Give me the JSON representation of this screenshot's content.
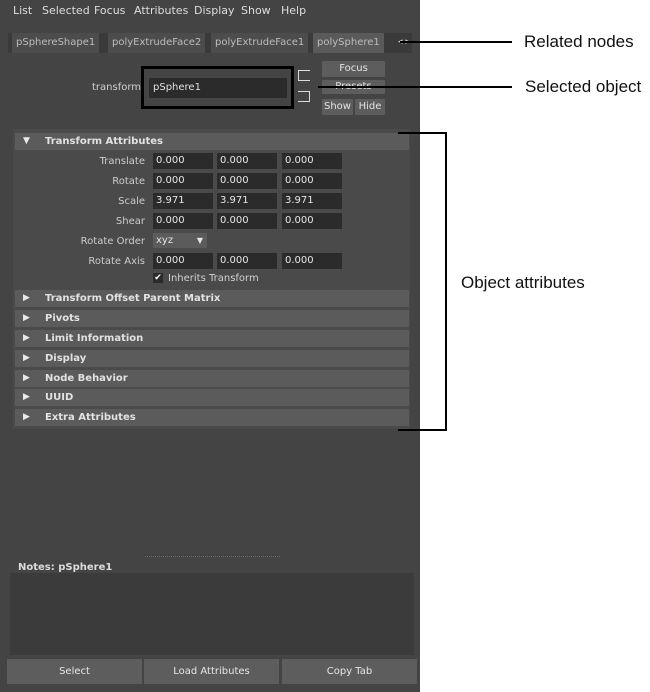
{
  "menu": [
    "List",
    "Selected",
    "Focus",
    "Attributes",
    "Display",
    "Show",
    "Help"
  ],
  "tabs": [
    "pSphereShape1",
    "polyExtrudeFace2",
    "polyExtrudeFace1",
    "polySphere1"
  ],
  "tab_arrows": "◂ ▸",
  "node": {
    "type_label": "transform",
    "name": "pSphere1"
  },
  "buttons": {
    "focus": "Focus",
    "presets": "Presets",
    "show": "Show",
    "hide": "Hide"
  },
  "transform_section": "Transform Attributes",
  "attributes": {
    "translate": {
      "label": "Translate",
      "values": [
        "0.000",
        "0.000",
        "0.000"
      ]
    },
    "rotate": {
      "label": "Rotate",
      "values": [
        "0.000",
        "0.000",
        "0.000"
      ]
    },
    "scale": {
      "label": "Scale",
      "values": [
        "3.971",
        "3.971",
        "3.971"
      ]
    },
    "shear": {
      "label": "Shear",
      "values": [
        "0.000",
        "0.000",
        "0.000"
      ]
    },
    "rotate_order": {
      "label": "Rotate Order",
      "value": "xyz"
    },
    "rotate_axis": {
      "label": "Rotate Axis",
      "values": [
        "0.000",
        "0.000",
        "0.000"
      ]
    },
    "inherits": {
      "label": "Inherits Transform",
      "checked": true,
      "mark": "✔"
    }
  },
  "sections": [
    "Transform Offset Parent Matrix",
    "Pivots",
    "Limit Information",
    "Display",
    "Node Behavior",
    "UUID",
    "Extra Attributes"
  ],
  "notes": {
    "label": "Notes:  pSphere1"
  },
  "bottom_buttons": [
    "Select",
    "Load Attributes",
    "Copy Tab"
  ],
  "callouts": {
    "related_nodes": "Related nodes",
    "selected_object": "Selected object",
    "object_attributes": "Object attributes"
  },
  "colors": {
    "panel_bg": "#444444",
    "field_bg": "#2b2b2b",
    "section_bg": "#5b5b5b",
    "highlight_border": "#000000"
  }
}
